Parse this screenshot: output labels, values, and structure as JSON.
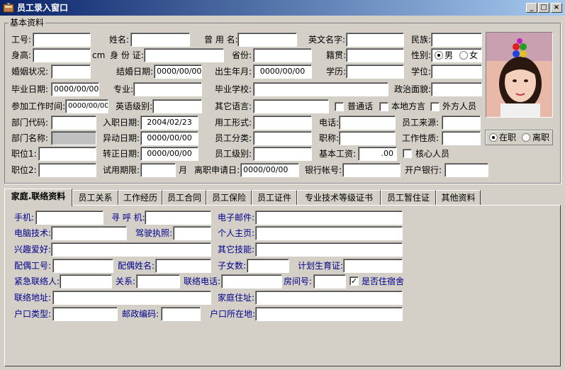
{
  "window": {
    "title": "员工录入窗口",
    "minimize": "_",
    "maximize": "□",
    "close": "×"
  },
  "basic_group": {
    "title": "基本资料"
  },
  "basic": {
    "emp_no": {
      "label": "工号:",
      "value": ""
    },
    "name": {
      "label": "姓名:",
      "value": ""
    },
    "alias": {
      "label": "曾 用 名:",
      "value": ""
    },
    "english_name": {
      "label": "英文名字:",
      "value": ""
    },
    "ethnic": {
      "label": "民族:",
      "value": ""
    },
    "height": {
      "label": "身高:",
      "value": "",
      "unit": "cm"
    },
    "id_card": {
      "label": "身 份 证:",
      "value": ""
    },
    "province": {
      "label": "省份:",
      "value": ""
    },
    "native_place": {
      "label": "籍贯:",
      "value": ""
    },
    "gender": {
      "label": "性别:",
      "male": "男",
      "female": "女",
      "selected": "male"
    },
    "marital": {
      "label": "婚姻状况:",
      "value": ""
    },
    "wedding_date": {
      "label": "结婚日期:",
      "value": "0000/00/00"
    },
    "birth_month": {
      "label": "出生年月:",
      "value": "0000/00/00"
    },
    "education": {
      "label": "学历:",
      "value": ""
    },
    "degree": {
      "label": "学位:",
      "value": ""
    },
    "grad_date": {
      "label": "毕业日期:",
      "value": "0000/00/00"
    },
    "major": {
      "label": "专业:",
      "value": ""
    },
    "school": {
      "label": "毕业学校:",
      "value": ""
    },
    "political": {
      "label": "政治面貌:",
      "value": ""
    },
    "work_start": {
      "label": "参加工作时间:",
      "value": "0000/00/00"
    },
    "english_level": {
      "label": "英语级别:",
      "value": ""
    },
    "other_lang": {
      "label": "其它语言:",
      "value": ""
    },
    "mandarin": {
      "label": "普通话",
      "checked": false
    },
    "dialect": {
      "label": "本地方言",
      "checked": false
    },
    "foreigner": {
      "label": "外方人员",
      "checked": false
    },
    "dept_code": {
      "label": "部门代码:",
      "value": ""
    },
    "join_date": {
      "label": "入职日期:",
      "value": "2004/02/23"
    },
    "employ_type": {
      "label": "用工形式:",
      "value": ""
    },
    "phone": {
      "label": "电话:",
      "value": ""
    },
    "emp_source": {
      "label": "员工来源:",
      "value": ""
    },
    "dept_name": {
      "label": "部门名称:",
      "value": ""
    },
    "change_date": {
      "label": "异动日期:",
      "value": "0000/00/00"
    },
    "emp_category": {
      "label": "员工分类:",
      "value": ""
    },
    "job_title": {
      "label": "职称:",
      "value": ""
    },
    "work_nature": {
      "label": "工作性质:",
      "value": ""
    },
    "status": {
      "active": "在职",
      "left": "离职",
      "selected": "active"
    },
    "position1": {
      "label": "职位1:",
      "value": ""
    },
    "regular_date": {
      "label": "转正日期:",
      "value": "0000/00/00"
    },
    "emp_level": {
      "label": "员工级别:",
      "value": ""
    },
    "base_salary": {
      "label": "基本工资:",
      "value": ".00"
    },
    "core_staff": {
      "label": "核心人员",
      "checked": false
    },
    "position2": {
      "label": "职位2:",
      "value": ""
    },
    "probation": {
      "label": "试用期限:",
      "value": "",
      "unit": "月"
    },
    "resign_date": {
      "label": "离职申请日:",
      "value": "0000/00/00"
    },
    "bank_account": {
      "label": "银行帐号:",
      "value": ""
    },
    "bank": {
      "label": "开户银行:",
      "value": ""
    }
  },
  "tabs": [
    "家庭.联络资料",
    "员工关系",
    "工作经历",
    "员工合同",
    "员工保险",
    "员工证件",
    "专业技术等级证书",
    "员工暂住证",
    "其他资料"
  ],
  "contact": {
    "mobile": {
      "label": "手机:",
      "value": ""
    },
    "pager": {
      "label": "寻 呼 机:",
      "value": ""
    },
    "email": {
      "label": "电子邮件:",
      "value": ""
    },
    "computer": {
      "label": "电脑技术:",
      "value": ""
    },
    "license": {
      "label": "驾驶执照:",
      "value": ""
    },
    "homepage": {
      "label": "个人主页:",
      "value": ""
    },
    "hobby": {
      "label": "兴趣爱好:",
      "value": ""
    },
    "other_skill": {
      "label": "其它技能:",
      "value": ""
    },
    "spouse_no": {
      "label": "配偶工号:",
      "value": ""
    },
    "spouse_name": {
      "label": "配偶姓名:",
      "value": ""
    },
    "children": {
      "label": "子女数:",
      "value": ""
    },
    "birth_cert": {
      "label": "计划生育证:",
      "value": ""
    },
    "emergency": {
      "label": "紧急联络人:",
      "value": ""
    },
    "relation": {
      "label": "关系:",
      "value": ""
    },
    "contact_phone": {
      "label": "联络电话:",
      "value": ""
    },
    "room": {
      "label": "房间号:",
      "value": ""
    },
    "dorm": {
      "label": "是否住宿舍",
      "checked": true
    },
    "address": {
      "label": "联络地址:",
      "value": ""
    },
    "home_address": {
      "label": "家庭住址:",
      "value": ""
    },
    "hukou_type": {
      "label": "户口类型:",
      "value": ""
    },
    "postcode": {
      "label": "邮政编码:",
      "value": ""
    },
    "hukou_place": {
      "label": "户口所在地:",
      "value": ""
    }
  }
}
